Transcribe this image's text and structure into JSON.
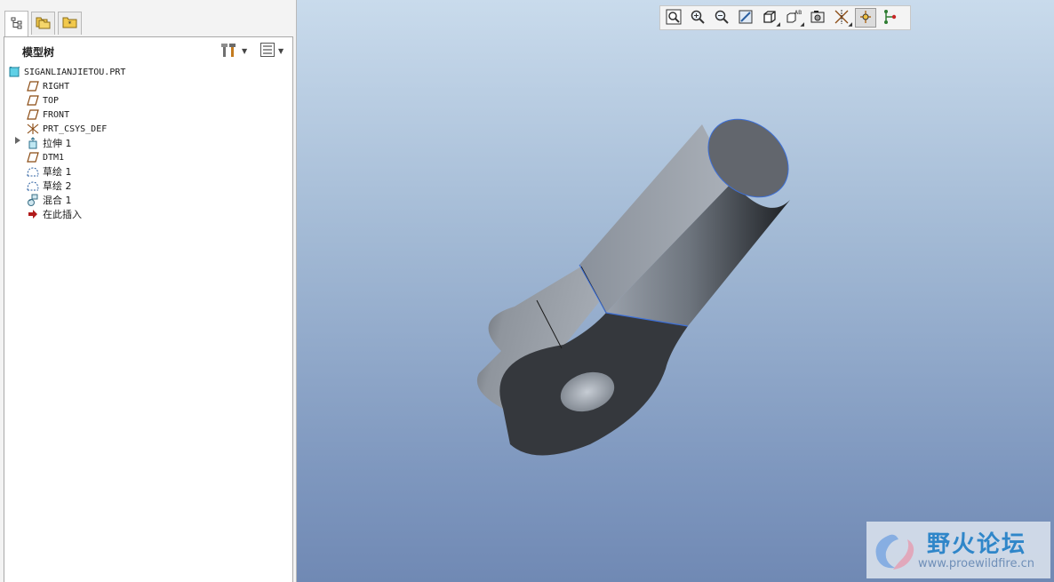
{
  "panel": {
    "tabs": [
      {
        "name": "model-tree",
        "icon": "tree-structure-icon",
        "active": true
      },
      {
        "name": "folder-browser",
        "icon": "folders-icon",
        "active": false
      },
      {
        "name": "favorites",
        "icon": "favorites-folder-icon",
        "active": false
      }
    ],
    "tree_title": "模型树",
    "header_buttons": [
      {
        "icon": "settings-tools-icon",
        "has_dropdown": true
      },
      {
        "icon": "show-list-icon",
        "has_dropdown": true
      }
    ]
  },
  "tree": {
    "root": {
      "label": "SIGANLIANJIETOU.PRT",
      "icon": "part-icon"
    },
    "items": [
      {
        "label": "RIGHT",
        "icon": "datum-plane-icon"
      },
      {
        "label": "TOP",
        "icon": "datum-plane-icon"
      },
      {
        "label": "FRONT",
        "icon": "datum-plane-icon"
      },
      {
        "label": "PRT_CSYS_DEF",
        "icon": "coordinate-system-icon"
      },
      {
        "label": "拉伸 1",
        "icon": "extrude-icon",
        "expandable": true
      },
      {
        "label": "DTM1",
        "icon": "datum-plane-icon"
      },
      {
        "label": "草绘 1",
        "icon": "sketch-icon"
      },
      {
        "label": "草绘 2",
        "icon": "sketch-icon"
      },
      {
        "label": "混合 1",
        "icon": "blend-icon"
      },
      {
        "label": "在此插入",
        "icon": "insert-here-arrow-icon"
      }
    ]
  },
  "viewport": {
    "toolbar": [
      {
        "name": "refit",
        "icon": "zoom-fit-icon"
      },
      {
        "name": "zoom-in",
        "icon": "zoom-in-icon"
      },
      {
        "name": "zoom-out",
        "icon": "zoom-out-icon"
      },
      {
        "name": "repaint",
        "icon": "repaint-icon"
      },
      {
        "name": "display-style",
        "icon": "display-style-icon",
        "dropdown": true
      },
      {
        "name": "saved-views",
        "icon": "saved-views-icon",
        "dropdown": true
      },
      {
        "name": "view-manager",
        "icon": "view-manager-icon"
      },
      {
        "name": "datum-display",
        "icon": "datum-display-icon",
        "dropdown": true
      },
      {
        "name": "spin-center",
        "icon": "spin-center-icon",
        "pressed": true
      },
      {
        "name": "annotation",
        "icon": "annotation-display-icon"
      }
    ],
    "background_top": "#c9dbec",
    "background_bottom": "#7089b4"
  },
  "watermark": {
    "title": "野火论坛",
    "url": "www.proewildfire.cn"
  }
}
